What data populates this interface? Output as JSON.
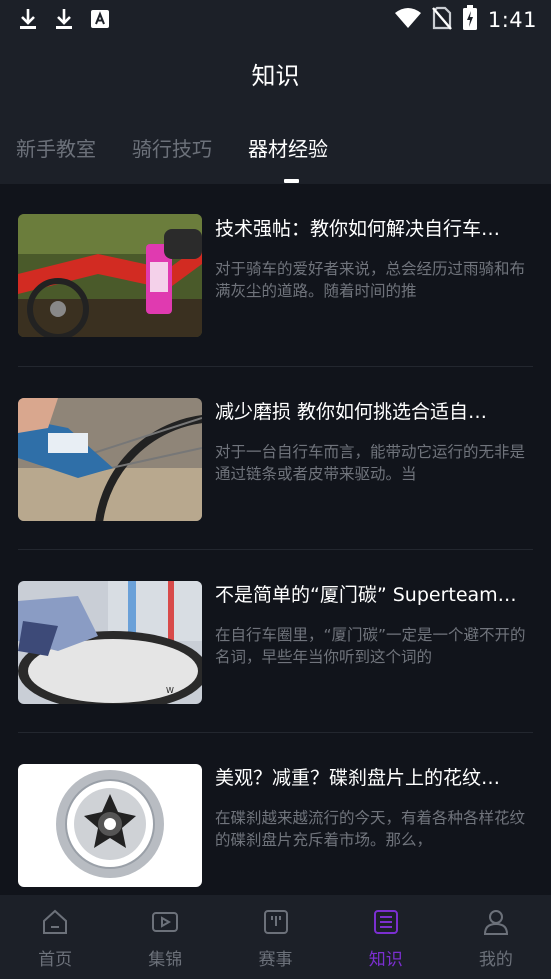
{
  "status_bar": {
    "time": "1:41"
  },
  "header": {
    "title": "知识"
  },
  "tabs": [
    {
      "label": "新手教室",
      "active": false
    },
    {
      "label": "骑行技巧",
      "active": false
    },
    {
      "label": "器材经验",
      "active": true
    }
  ],
  "articles": [
    {
      "title": "技术强帖：教你如何解决自行车…",
      "summary": "对于骑车的爱好者来说，总会经历过雨骑和布满灰尘的道路。随着时间的推"
    },
    {
      "title": "减少磨损 教你如何挑选合适自…",
      "summary": "对于一台自行车而言，能带动它运行的无非是通过链条或者皮带来驱动。当"
    },
    {
      "title": "不是简单的“厦门碳” Superteam…",
      "summary": "在自行车圈里，“厦门碳”一定是一个避不开的名词，早些年当你听到这个词的"
    },
    {
      "title": "美观？减重？碟刹盘片上的花纹…",
      "summary": "在碟刹越来越流行的今天，有着各种各样花纹的碟刹盘片充斥着市场。那么，"
    }
  ],
  "bottom_nav": [
    {
      "label": "首页",
      "icon": "home-icon",
      "active": false
    },
    {
      "label": "集锦",
      "icon": "video-icon",
      "active": false
    },
    {
      "label": "赛事",
      "icon": "event-icon",
      "active": false
    },
    {
      "label": "知识",
      "icon": "knowledge-list-icon",
      "active": true
    },
    {
      "label": "我的",
      "icon": "user-icon",
      "active": false
    }
  ],
  "colors": {
    "header_bg": "#1c2028",
    "page_bg": "#11141b",
    "active_nav": "#7b2fd0",
    "inactive_text": "#6c717a"
  }
}
